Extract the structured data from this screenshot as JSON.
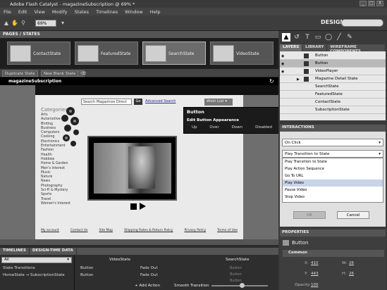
{
  "window": {
    "title": "Adobe Flash Catalyst - magazineSubscription @ 69% *",
    "controls": [
      "_",
      "□",
      "X"
    ]
  },
  "menu": [
    "File",
    "Edit",
    "View",
    "Modify",
    "States",
    "Timelines",
    "Window",
    "Help"
  ],
  "toolbar": {
    "zoom": "69%",
    "workspace": "DESIGN"
  },
  "pages_states": {
    "header": "PAGES / STATES",
    "states": [
      {
        "label": "ContactState",
        "selected": false
      },
      {
        "label": "FeaturedState",
        "selected": false
      },
      {
        "label": "SearchState",
        "selected": true
      },
      {
        "label": "VideoState",
        "selected": false
      }
    ],
    "duplicate_label": "Duplicate State",
    "new_blank_label": "New Blank State"
  },
  "artboard": {
    "title": "magazineSubscription",
    "search_placeholder": "Search Magazines Direct",
    "go_label": "Go",
    "advanced_search": "Advanced Search",
    "wish_list": "Wish List",
    "categories_title": "Categories",
    "categories": [
      "Arts",
      "Automotive",
      "Birding",
      "Business",
      "Computers",
      "Cooking",
      "Electronics",
      "Entertainment",
      "Fashion",
      "Health",
      "Hobbies",
      "Home & Garden",
      "Men's Interest",
      "Music",
      "Nature",
      "News",
      "Photography",
      "Sci-Fi & Mystery",
      "Sports",
      "Travel",
      "Women's Interest"
    ],
    "footer_links": [
      "My account",
      "Contact Us",
      "Site Map",
      "Shipping Rates & Return Policy",
      "Privacy Policy",
      "Terms of Use"
    ]
  },
  "button_popup": {
    "title": "Button",
    "section": "Edit Button Appearance",
    "states": [
      "Up",
      "Over",
      "Down",
      "Disabled"
    ]
  },
  "tools": [
    "▲",
    "↺",
    "T",
    "▭",
    "◯",
    "╱",
    "✎"
  ],
  "layers": {
    "tabs": [
      "LAYERS",
      "LIBRARY",
      "WIREFRAME COMPONENTS"
    ],
    "rows": [
      {
        "name": "Button",
        "selected": false
      },
      {
        "name": "Button",
        "selected": true
      },
      {
        "name": "VideoPlayer",
        "selected": false
      },
      {
        "name": "Magazine Detail State",
        "selected": false
      },
      {
        "name": "SearchState",
        "selected": false
      },
      {
        "name": "FeaturedState",
        "selected": false
      },
      {
        "name": "ContactState",
        "selected": false
      },
      {
        "name": "SubscriptionState",
        "selected": false
      }
    ]
  },
  "interactions": {
    "header": "INTERACTIONS",
    "trigger": "On Click",
    "action": "Play Transition to State",
    "options": [
      "Play Transition to State",
      "Play Action Sequence",
      "Go To URL",
      "Play Video",
      "Pause Video",
      "Stop Video"
    ],
    "highlighted_index": 3,
    "ok_label": "OK",
    "cancel_label": "Cancel"
  },
  "properties": {
    "header": "PROPERTIES",
    "component": "Button",
    "section": "Common",
    "x": "410",
    "y": "443",
    "w": "26",
    "h": "26",
    "opacity_label": "Opacity:",
    "opacity": "100"
  },
  "timelines": {
    "tabs": [
      "TIMELINES",
      "DESIGN-TIME DATA"
    ],
    "filter": "All",
    "rows": [
      "State Transitions",
      "HomeState  →  SubscriptionState"
    ],
    "target_state": "VideoState",
    "search_state": "SearchState",
    "items": [
      "Button",
      "Button"
    ],
    "effects": [
      "Fade Out",
      "Fade Out"
    ],
    "add_action": "+ Add Action",
    "smooth_transition": "Smooth Transition",
    "ghost_labels": [
      "Button",
      "Button",
      "Button"
    ]
  }
}
